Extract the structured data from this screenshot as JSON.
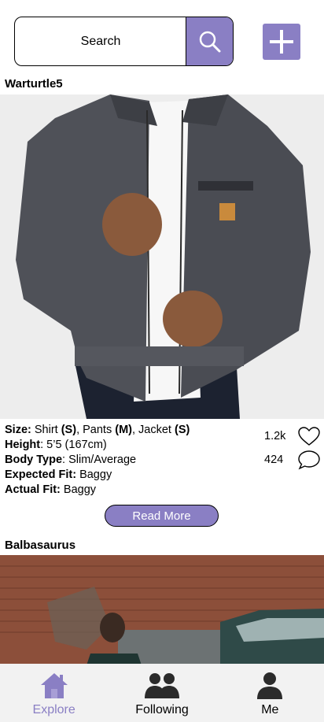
{
  "search": {
    "label": "Search",
    "placeholder": ""
  },
  "colors": {
    "accent": "#8a7fc4",
    "nav_bg": "#f2f2f2"
  },
  "posts": [
    {
      "username": "Warturtle5",
      "details": {
        "size_label": "Size:",
        "size_shirt_word": " Shirt ",
        "size_shirt": "(S)",
        "size_pants_word": ", Pants ",
        "size_pants": "(M)",
        "size_jacket_word": ", Jacket ",
        "size_jacket": "(S)",
        "height_label": "Height",
        "height_value": ": 5’5 (167cm)",
        "body_label": "Body Type",
        "body_value": ": Slim/Average",
        "expected_label": "Expected Fit:",
        "expected_value": " Baggy",
        "actual_label": "Actual Fit:",
        "actual_value": " Baggy"
      },
      "likes": "1.2k",
      "comments": "424",
      "read_more": "Read More"
    },
    {
      "username": "Balbasaurus"
    }
  ],
  "nav": [
    {
      "label": "Explore",
      "icon": "home-icon",
      "active": true
    },
    {
      "label": "Following",
      "icon": "people-icon",
      "active": false
    },
    {
      "label": "Me",
      "icon": "person-icon",
      "active": false
    }
  ]
}
